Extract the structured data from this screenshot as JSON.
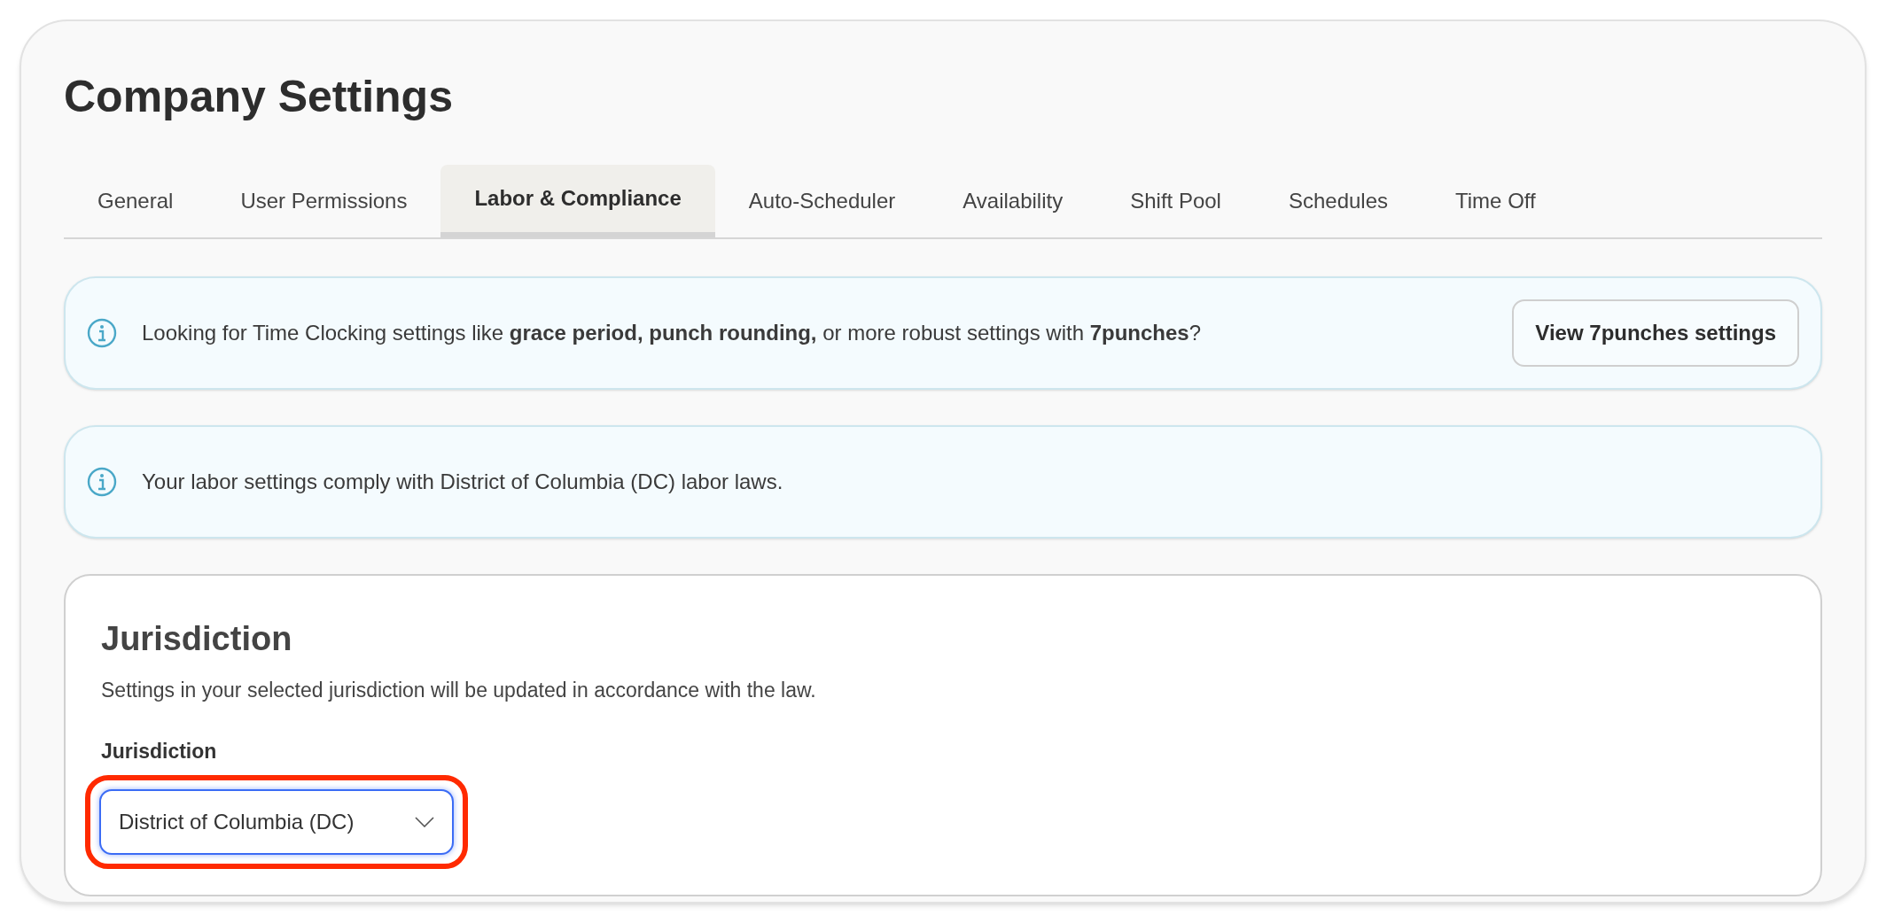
{
  "title": "Company Settings",
  "tabs": [
    {
      "label": "General",
      "selected": false
    },
    {
      "label": "User Permissions",
      "selected": false
    },
    {
      "label": "Labor & Compliance",
      "selected": true
    },
    {
      "label": "Auto-Scheduler",
      "selected": false
    },
    {
      "label": "Availability",
      "selected": false
    },
    {
      "label": "Shift Pool",
      "selected": false
    },
    {
      "label": "Schedules",
      "selected": false
    },
    {
      "label": "Time Off",
      "selected": false
    }
  ],
  "banners": [
    {
      "text": "Looking for Time Clocking settings like **grace period, punch rounding,** or more robust settings with **7punches**?",
      "button": "View 7punches settings"
    },
    {
      "text": "Your labor settings comply with District of Columbia (DC) labor laws."
    }
  ],
  "jurisdiction": {
    "heading": "Jurisdiction",
    "description": "Settings in your selected jurisdiction will be updated in accordance with the law.",
    "label": "Jurisdiction",
    "value": "District of Columbia (DC)",
    "highlighted": true
  }
}
